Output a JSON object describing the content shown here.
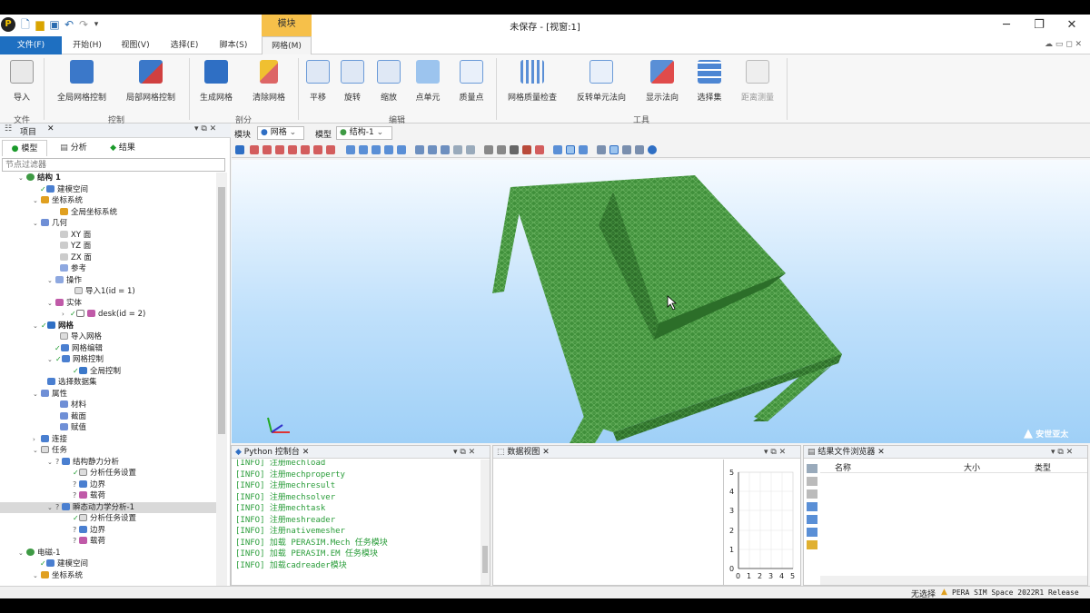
{
  "window": {
    "title": "未保存 - [视窗:1]",
    "context_tab": "模块"
  },
  "menus": [
    "文件(F)",
    "开始(H)",
    "视图(V)",
    "选择(E)",
    "脚本(S)",
    "网格(M)"
  ],
  "ribbon": {
    "buttons": [
      "导入",
      "全局网格控制",
      "局部网格控制",
      "生成网格",
      "清除网格",
      "平移",
      "旋转",
      "缩放",
      "点单元",
      "质量点",
      "网格质量检查",
      "反转单元法向",
      "显示法向",
      "选择集",
      "距离测量"
    ],
    "groups": [
      "文件",
      "控制",
      "剖分",
      "编辑",
      "工具"
    ]
  },
  "left_panel": {
    "title": "项目",
    "tabs": [
      "模型",
      "分析",
      "结果"
    ],
    "filter_placeholder": "节点过滤器",
    "tree": [
      "结构 1",
      "建模空间",
      "坐标系统",
      "全局坐标系统",
      "几何",
      "XY 面",
      "YZ 面",
      "ZX 面",
      "参考",
      "操作",
      "导入1(id = 1)",
      "实体",
      "desk(id = 2)",
      "网格",
      "导入网格",
      "网格编辑",
      "网格控制",
      "全局控制",
      "选择数据集",
      "属性",
      "材料",
      "截面",
      "赋值",
      "连接",
      "任务",
      "结构静力分析",
      "分析任务设置",
      "边界",
      "载荷",
      "瞬态动力学分析-1",
      "分析任务设置",
      "边界",
      "载荷",
      "电磁-1",
      "建模空间",
      "坐标系统"
    ]
  },
  "viewport_toolbar": {
    "module_label": "模块",
    "module_value": "网格",
    "model_label": "模型",
    "model_value": "结构-1"
  },
  "console": {
    "title": "Python 控制台",
    "lines": [
      "[INFO] 注册mechload",
      "[INFO] 注册mechproperty",
      "[INFO] 注册mechresult",
      "[INFO] 注册mechsolver",
      "[INFO] 注册mechtask",
      "[INFO] 注册meshreader",
      "[INFO] 注册nativemesher",
      "[INFO] 加载 PERASIM.Mech 任务模块",
      "[INFO] 加载 PERASIM.EM 任务模块",
      "[INFO] 加载cadreader模块"
    ]
  },
  "data_view": {
    "title": "数据视图",
    "y_ticks": [
      "0",
      "1",
      "2",
      "3",
      "4",
      "5"
    ],
    "x_ticks": [
      "0",
      "1",
      "2",
      "3",
      "4",
      "5"
    ]
  },
  "results_browser": {
    "title": "结果文件浏览器",
    "columns": [
      "名称",
      "大小",
      "类型"
    ]
  },
  "status": {
    "selection": "无选择",
    "product": "PERA SIM Space 2022R1 Release"
  },
  "brand": {
    "watermark": "安世亚太"
  },
  "colors": {
    "accent": "#1e6fc1",
    "context_tab": "#f6c04a",
    "mesh": "#3f8f3a",
    "console_text": "#2a9d3a"
  }
}
